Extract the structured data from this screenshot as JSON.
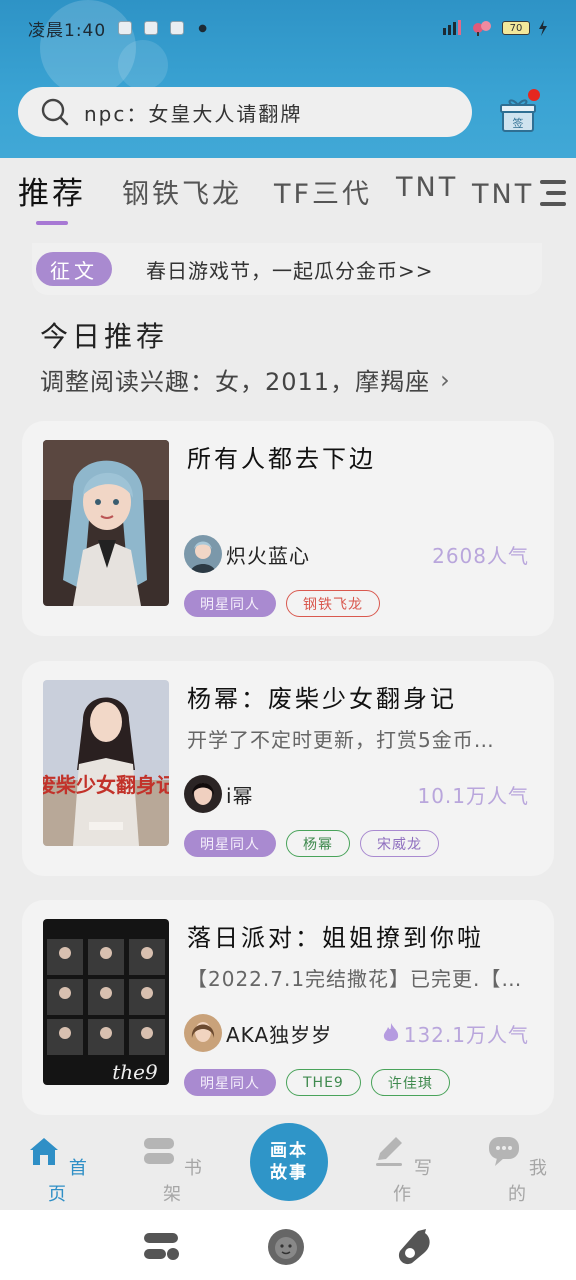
{
  "status_bar": {
    "time": "凌晨1:40",
    "battery": "70"
  },
  "search": {
    "placeholder": "npc：女皇大人请翻牌"
  },
  "gift": {
    "label": "签"
  },
  "tabs": [
    {
      "label": "推荐",
      "active": true
    },
    {
      "label": "钢铁飞龙"
    },
    {
      "label": "TF三代"
    },
    {
      "label": "TNT"
    },
    {
      "label": "TNT时"
    }
  ],
  "banner": {
    "badge": "征文",
    "text": "春日游戏节，一起瓜分金币>>"
  },
  "recommend": {
    "title": "今日推荐",
    "subtitle": "调整阅读兴趣：女，2011，摩羯座"
  },
  "books": [
    {
      "title": "所有人都去下边",
      "description": "",
      "author": "炽火蓝心",
      "popularity": "2608人气",
      "hot": false,
      "tags": [
        {
          "label": "明星同人",
          "style": "fill"
        },
        {
          "label": "钢铁飞龙",
          "style": "red"
        }
      ]
    },
    {
      "title": "杨幂：废柴少女翻身记",
      "description": "开学了不定时更新，打赏5金币…",
      "author": "i幂",
      "popularity": "10.1万人气",
      "hot": false,
      "cover_text": "废柴少女翻身记",
      "tags": [
        {
          "label": "明星同人",
          "style": "fill"
        },
        {
          "label": "杨幂",
          "style": "green"
        },
        {
          "label": "宋威龙",
          "style": "purple"
        }
      ]
    },
    {
      "title": "落日派对：姐姐撩到你啦",
      "description": "【2022.7.1完结撒花】已完更.【…",
      "author": "AKA独岁岁",
      "popularity": "132.1万人气",
      "hot": true,
      "cover_text": "the9",
      "tags": [
        {
          "label": "明星同人",
          "style": "fill"
        },
        {
          "label": "THE9",
          "style": "green"
        },
        {
          "label": "许佳琪",
          "style": "green"
        }
      ]
    }
  ],
  "bottom_nav": {
    "home": "首页",
    "shelf": "书架",
    "center": [
      "画本",
      "故事"
    ],
    "write": "写作",
    "mine": "我的"
  },
  "colors": {
    "header": "#3aa3d3",
    "accent_purple": "#a98ad0",
    "nav_active": "#2f8fc6"
  }
}
